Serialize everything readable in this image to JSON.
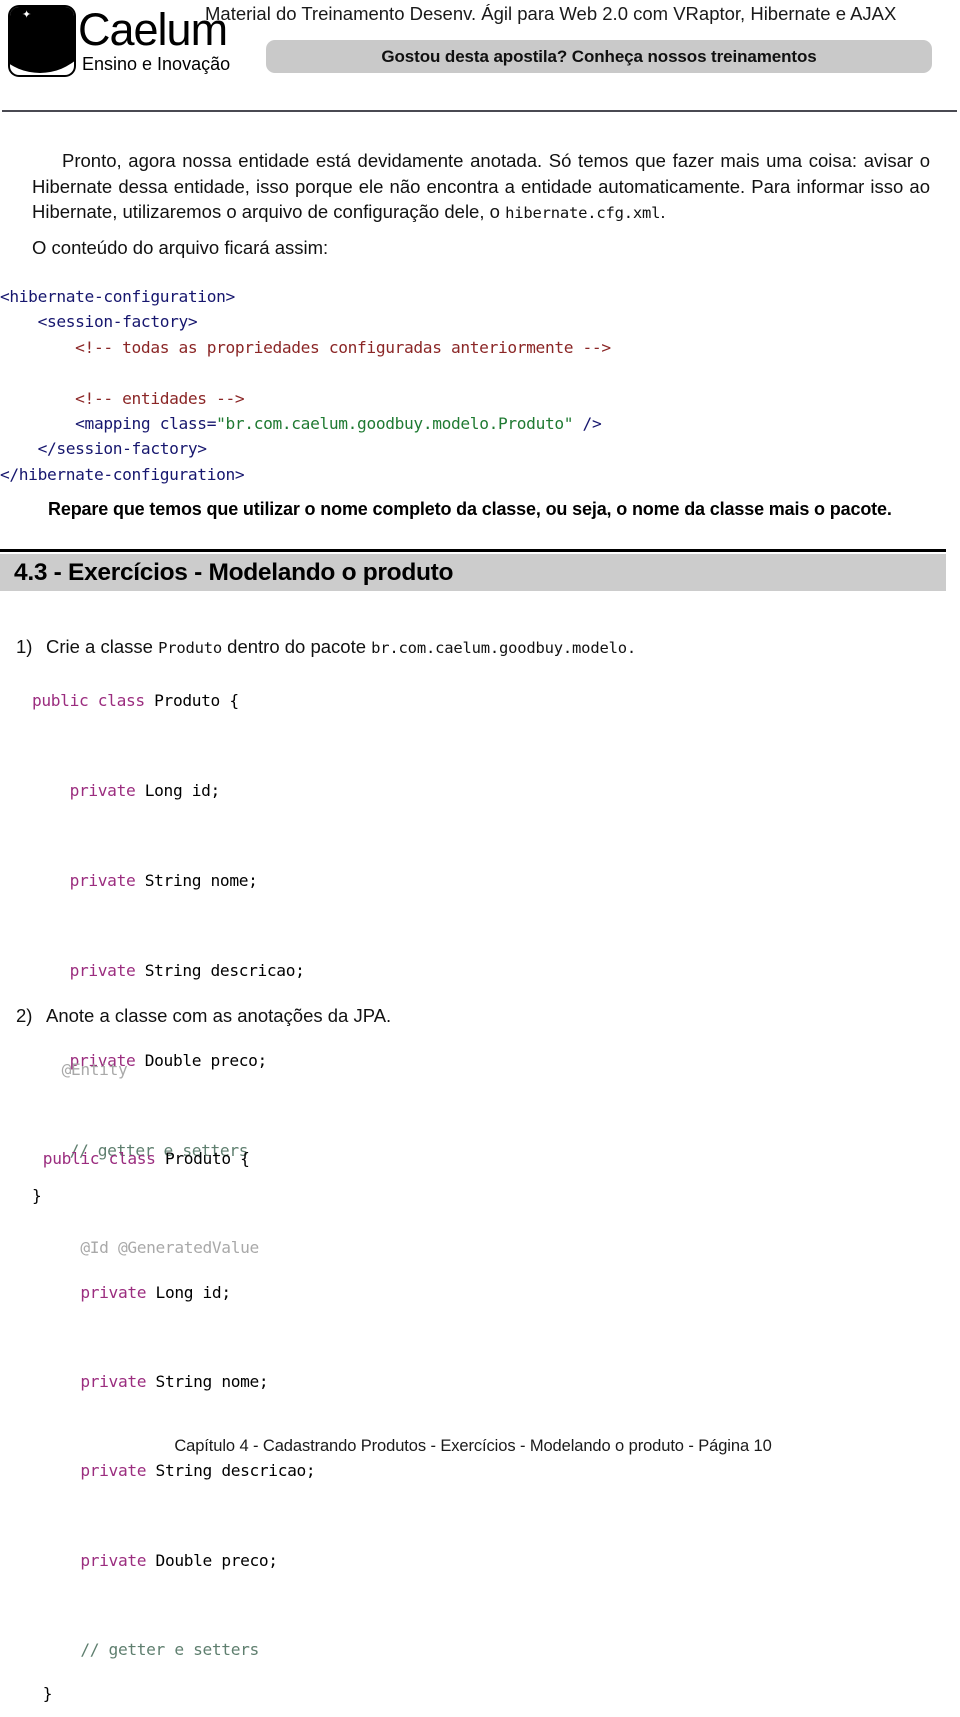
{
  "header": {
    "title": "Material do Treinamento Desenv. Ágil para Web 2.0 com VRaptor, Hibernate e AJAX",
    "banner_text": "Gostou desta apostila? Conheça nossos treinamentos",
    "logo_word": "Caelum",
    "logo_tagline": "Ensino e Inovação"
  },
  "body": {
    "paragraph_1_a": "Pronto, agora nossa entidade está devidamente anotada.  Só temos que fazer mais uma coisa: avisar o Hibernate dessa entidade, isso porque ele não encontra a entidade automaticamente.  Para informar isso ao Hibernate, utilizaremos o arquivo de configuração dele, o ",
    "paragraph_1_code": "hibernate.cfg.xml",
    "paragraph_1_b": ".",
    "paragraph_2": "O conteúdo do arquivo ficará assim:",
    "note_bold": "Repare que temos que utilizar o nome completo da classe, ou seja, o nome da classe mais o pacote."
  },
  "xml_code": {
    "l1_tag": "<hibernate-configuration>",
    "l2_tag": "    <session-factory>",
    "l3_comment": "        <!-- todas as propriedades configuradas anteriormente -->",
    "l4_blank": "",
    "l5_comment": "        <!-- entidades -->",
    "l6_tag_a": "        <mapping class=",
    "l6_string": "\"br.com.caelum.goodbuy.modelo.Produto\"",
    "l6_tag_b": " />",
    "l7_tag": "    </session-factory>",
    "l8_tag": "</hibernate-configuration>"
  },
  "section": {
    "heading": "4.3 - Exercícios - Modelando o produto"
  },
  "exercises": [
    {
      "number": "1)",
      "text_a": "Crie a classe ",
      "code_a": "Produto",
      "text_b": " dentro do pacote ",
      "code_b": "br.com.caelum.goodbuy.modelo."
    },
    {
      "number": "2)",
      "text_a": "Anote a classe com as anotações da JPA.",
      "code_a": "",
      "text_b": "",
      "code_b": ""
    }
  ],
  "java_code_1": {
    "kw_public": "public",
    "kw_class": "class",
    "class_name": " Produto {",
    "kw_private": "private",
    "f1": " Long id;",
    "f2": " String nome;",
    "f3": " String descricao;",
    "f4": " Double preco;",
    "comment": "// getter e setters",
    "close": "}"
  },
  "java_code_2": {
    "ann_entity": "@Entity",
    "kw_public": "public",
    "kw_class": "class",
    "class_name": " Produto {",
    "ann_id": "@Id @GeneratedValue",
    "kw_private": "private",
    "f1": " Long id;",
    "f2": " String nome;",
    "f3": " String descricao;",
    "f4": " Double preco;",
    "comment": "// getter e setters",
    "close": "}"
  },
  "footer": {
    "text": "Capítulo 4 - Cadastrando Produtos -  Exercícios - Modelando o produto - Página 10"
  },
  "colors": {
    "xml_tag": "#16166e",
    "xml_comment": "#8b2626",
    "xml_string": "#1f7a32",
    "java_keyword": "#9b2d7f",
    "java_annotation": "#a9a9a9",
    "java_comment": "#5f7f6f",
    "band_gray": "#cccccc",
    "banner_gray": "#c9c9c9"
  }
}
